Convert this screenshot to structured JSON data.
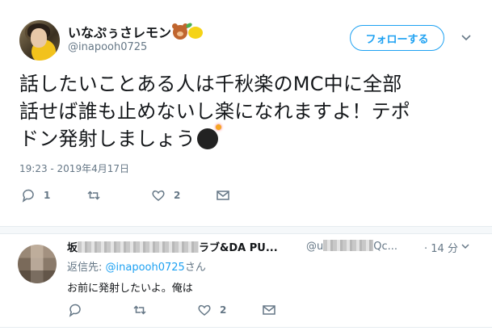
{
  "tweet": {
    "display_name": "いなぷぅさレモン",
    "handle": "@inapooh0725",
    "follow_label": "フォローする",
    "text_line1": "話したいことある人は千秋楽のMC中に全部",
    "text_line2": "話せば誰も止めないし楽になれますよ！テポ",
    "text_line3": "ドン発射しましょう",
    "timestamp": "19:23 - 2019年4月17日",
    "reply_count": "1",
    "retweet_count": "",
    "like_count": "2",
    "emoji_icons": [
      "bear-face-icon",
      "lemon-icon"
    ],
    "text_emoji": "bomb-icon"
  },
  "reply": {
    "name_start": "坂",
    "name_visible": "ラブ&DA PU...",
    "handle_start": "@u",
    "handle_end": "Qc...",
    "time": "· 14 分",
    "reply_to_label": "返信先: ",
    "reply_to_mention": "@inapooh0725",
    "reply_to_suffix": "さん",
    "text": "お前に発射したいよ。俺は",
    "reply_count": "",
    "retweet_count": "",
    "like_count": "2"
  },
  "colors": {
    "accent": "#1da1f2",
    "secondary_text": "#657786",
    "primary_text": "#14171a",
    "divider": "#e6ecf0"
  }
}
